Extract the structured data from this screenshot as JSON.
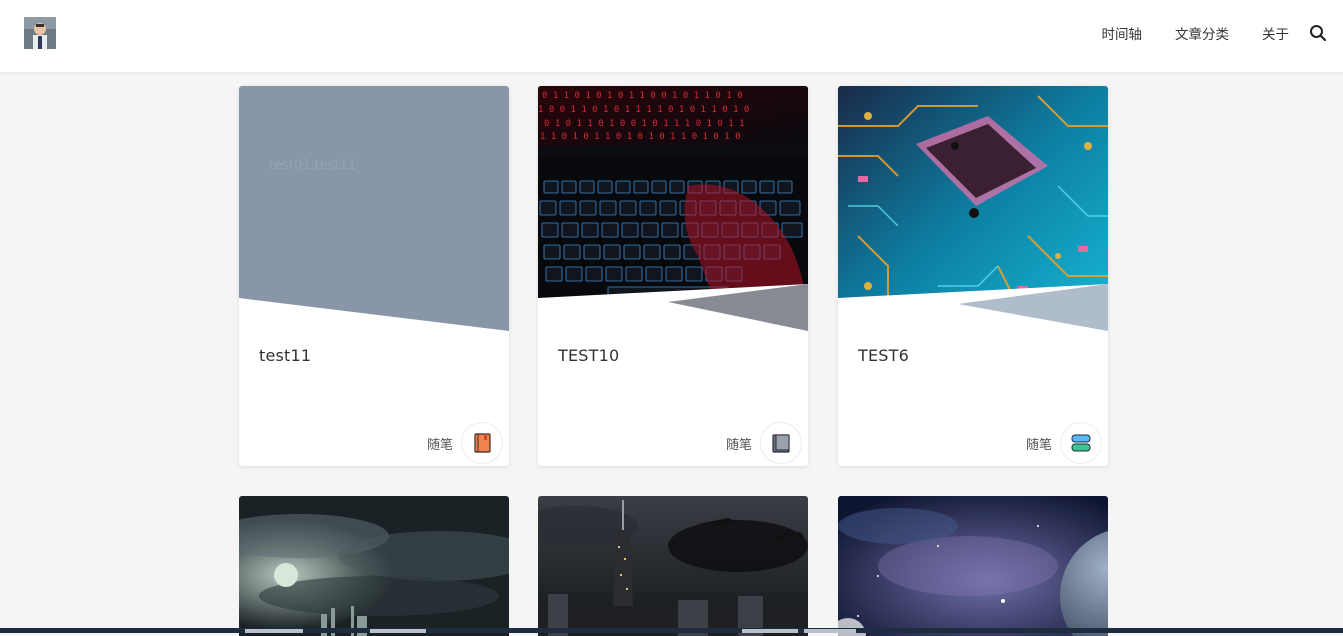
{
  "header": {
    "avatar_name": "user-avatar",
    "nav": [
      "时间轴",
      "文章分类",
      "关于"
    ],
    "search_icon": "search-icon"
  },
  "cards": [
    {
      "title": "test11",
      "cover_text": "test01,test11",
      "category": "随笔",
      "icon": "notebook-icon",
      "icon_color": "#f0834f"
    },
    {
      "title": "TEST10",
      "cover_text": "",
      "category": "随笔",
      "icon": "notebook-icon",
      "icon_color": "#5a6270"
    },
    {
      "title": "TEST6",
      "cover_text": "",
      "category": "随笔",
      "icon": "stack-icon",
      "icon_color": "#3cc492"
    }
  ],
  "colors": {
    "background": "#f5f5f5",
    "card_placeholder": "#8896a8",
    "header_bg": "#ffffff"
  }
}
